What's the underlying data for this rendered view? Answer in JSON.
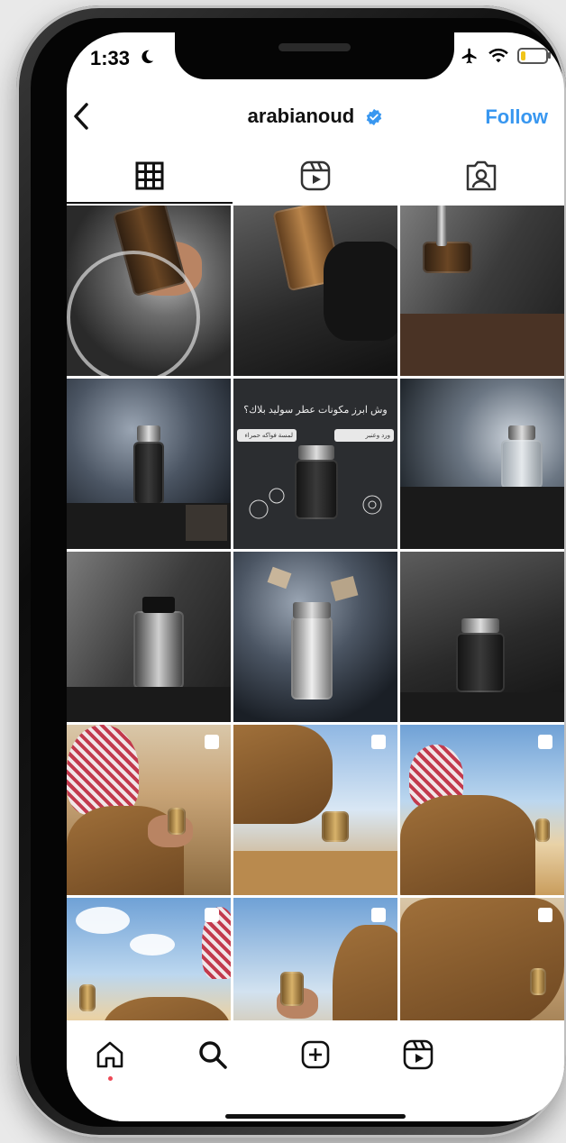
{
  "status_bar": {
    "time": "1:33",
    "icons": [
      "moon-icon",
      "airplane-icon",
      "wifi-icon",
      "battery-icon"
    ],
    "battery_level": 0.2
  },
  "header": {
    "back_icon": "chevron-left-icon",
    "username": "arabianoud",
    "verified_icon": "verified-badge-icon",
    "follow_label": "Follow"
  },
  "tabs": [
    {
      "icon": "grid-icon",
      "active": true
    },
    {
      "icon": "reels-icon",
      "active": false
    },
    {
      "icon": "tagged-icon",
      "active": false
    }
  ],
  "grid_post": {
    "arabic_title": "وش ابرز مكونات عطر سوليد بلاك؟",
    "label_left": "لمسة فواكه حمراء",
    "label_right": "ورد وعنبر"
  },
  "bottom_nav": {
    "items": [
      "home-icon",
      "search-icon",
      "create-post-icon",
      "reels-icon"
    ]
  },
  "colors": {
    "accent": "#3897f0",
    "verified": "#3897f0",
    "notification_dot": "#ed4956"
  }
}
